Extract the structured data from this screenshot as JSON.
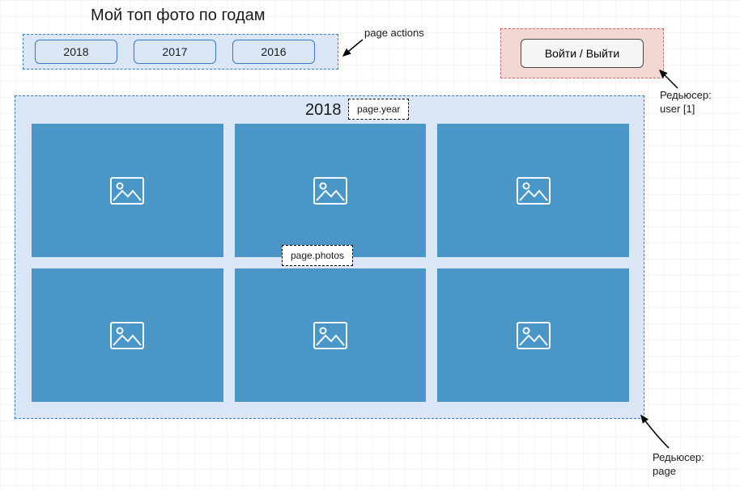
{
  "title": "Мой топ фото по годам",
  "actions": {
    "years": [
      "2018",
      "2017",
      "2016"
    ]
  },
  "login": {
    "button_label": "Войти / Выйти"
  },
  "page": {
    "year": "2018",
    "photos_count": 6
  },
  "tags": {
    "page_actions": "page actions",
    "page_year": "page.year",
    "page_photos": "page.photos"
  },
  "annotations": {
    "reducer_user": "Редьюсер:\nuser [1]",
    "reducer_page": "Редьюсер:\npage"
  }
}
